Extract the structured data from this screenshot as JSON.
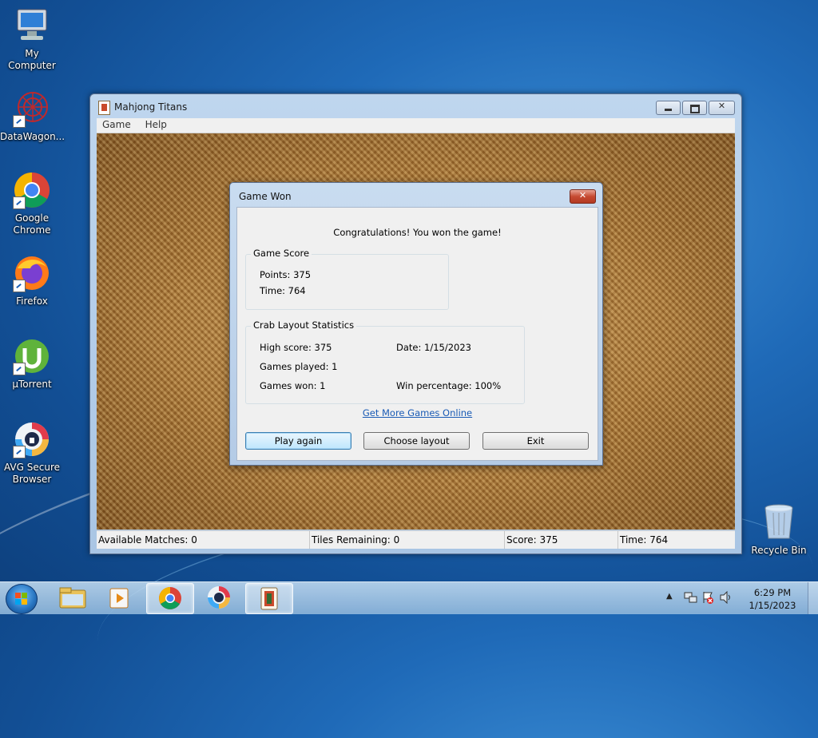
{
  "desktop": {
    "icons": [
      {
        "label": "My Computer",
        "icon": "computer-icon"
      },
      {
        "label": "DataWagon...",
        "icon": "datawagon-icon"
      },
      {
        "label": "Google Chrome",
        "icon": "chrome-icon"
      },
      {
        "label": "Firefox",
        "icon": "firefox-icon"
      },
      {
        "label": "µTorrent",
        "icon": "utorrent-icon"
      },
      {
        "label": "AVG Secure Browser",
        "icon": "avg-browser-icon"
      },
      {
        "label": "Recycle Bin",
        "icon": "recycle-bin-icon"
      }
    ]
  },
  "window": {
    "title": "Mahjong Titans",
    "menu": [
      "Game",
      "Help"
    ],
    "status": {
      "available_matches": "Available Matches: 0",
      "tiles_remaining": "Tiles Remaining: 0",
      "score": "Score: 375",
      "time": "Time: 764"
    }
  },
  "dialog": {
    "title": "Game Won",
    "message": "Congratulations! You won the game!",
    "game_score": {
      "label": "Game Score",
      "points": "Points: 375",
      "time": "Time: 764"
    },
    "stats": {
      "label": "Crab Layout Statistics",
      "high_score": "High score: 375",
      "date": "Date: 1/15/2023",
      "games_played": "Games played: 1",
      "games_won": "Games won: 1",
      "win_percentage": "Win percentage: 100%"
    },
    "link": "Get More Games Online",
    "buttons": {
      "play_again": "Play again",
      "choose_layout": "Choose layout",
      "exit": "Exit"
    }
  },
  "taskbar": {
    "clock_time": "6:29 PM",
    "clock_date": "1/15/2023",
    "pinned": [
      "windows-explorer-icon",
      "media-player-icon",
      "chrome-icon",
      "avg-browser-icon",
      "mahjong-titans-icon"
    ]
  },
  "colors": {
    "link": "#1a5bb5",
    "desktop_bg": "#1f6ab8"
  }
}
